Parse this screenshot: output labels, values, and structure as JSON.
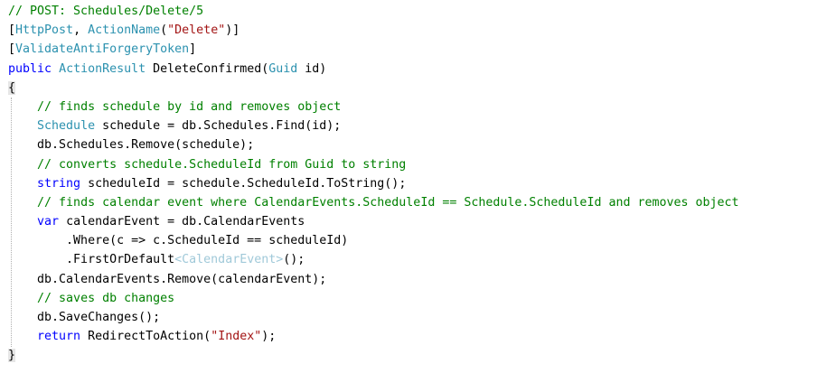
{
  "colors": {
    "comment": "#008000",
    "keyword": "#0000ff",
    "type": "#2b91af",
    "string": "#a31515",
    "plain": "#000000",
    "generic_faded": "#a0c9d9",
    "background": "#ffffff"
  },
  "code": {
    "lines": [
      {
        "indent": 0,
        "tokens": [
          {
            "t": "// POST: Schedules/Delete/5",
            "k": "comment"
          }
        ]
      },
      {
        "indent": 0,
        "tokens": [
          {
            "t": "[",
            "k": "plain"
          },
          {
            "t": "HttpPost",
            "k": "type"
          },
          {
            "t": ", ",
            "k": "plain"
          },
          {
            "t": "ActionName",
            "k": "type"
          },
          {
            "t": "(",
            "k": "plain"
          },
          {
            "t": "\"Delete\"",
            "k": "string"
          },
          {
            "t": ")]",
            "k": "plain"
          }
        ]
      },
      {
        "indent": 0,
        "tokens": [
          {
            "t": "[",
            "k": "plain"
          },
          {
            "t": "ValidateAntiForgeryToken",
            "k": "type"
          },
          {
            "t": "]",
            "k": "plain"
          }
        ]
      },
      {
        "indent": 0,
        "tokens": [
          {
            "t": "public",
            "k": "keyword"
          },
          {
            "t": " ",
            "k": "plain"
          },
          {
            "t": "ActionResult",
            "k": "type"
          },
          {
            "t": " DeleteConfirmed(",
            "k": "plain"
          },
          {
            "t": "Guid",
            "k": "type"
          },
          {
            "t": " id)",
            "k": "plain"
          }
        ]
      },
      {
        "indent": 0,
        "tokens": [
          {
            "t": "{",
            "k": "brace"
          }
        ]
      },
      {
        "indent": 4,
        "tokens": [
          {
            "t": "// finds schedule by id and removes object",
            "k": "comment"
          }
        ]
      },
      {
        "indent": 4,
        "tokens": [
          {
            "t": "Schedule",
            "k": "type"
          },
          {
            "t": " schedule = db.Schedules.Find(id);",
            "k": "plain"
          }
        ]
      },
      {
        "indent": 4,
        "tokens": [
          {
            "t": "db.Schedules.Remove(schedule);",
            "k": "plain"
          }
        ]
      },
      {
        "indent": 4,
        "tokens": [
          {
            "t": "// converts schedule.ScheduleId from Guid to string",
            "k": "comment"
          }
        ]
      },
      {
        "indent": 4,
        "tokens": [
          {
            "t": "string",
            "k": "keyword"
          },
          {
            "t": " scheduleId = schedule.ScheduleId.ToString();",
            "k": "plain"
          }
        ]
      },
      {
        "indent": 4,
        "tokens": [
          {
            "t": "// finds calendar event where CalendarEvents.ScheduleId == Schedule.ScheduleId and removes object",
            "k": "comment"
          }
        ]
      },
      {
        "indent": 4,
        "tokens": [
          {
            "t": "var",
            "k": "keyword"
          },
          {
            "t": " calendarEvent = db.CalendarEvents",
            "k": "plain"
          }
        ]
      },
      {
        "indent": 8,
        "tokens": [
          {
            "t": ".Where(c => c.ScheduleId == scheduleId)",
            "k": "plain"
          }
        ]
      },
      {
        "indent": 8,
        "tokens": [
          {
            "t": ".FirstOrDefault",
            "k": "plain"
          },
          {
            "t": "<",
            "k": "faded"
          },
          {
            "t": "CalendarEvent",
            "k": "faded"
          },
          {
            "t": ">",
            "k": "faded"
          },
          {
            "t": "();",
            "k": "plain"
          }
        ]
      },
      {
        "indent": 4,
        "tokens": [
          {
            "t": "db.CalendarEvents.Remove(calendarEvent);",
            "k": "plain"
          }
        ]
      },
      {
        "indent": 4,
        "tokens": [
          {
            "t": "// saves db changes",
            "k": "comment"
          }
        ]
      },
      {
        "indent": 4,
        "tokens": [
          {
            "t": "db.SaveChanges();",
            "k": "plain"
          }
        ]
      },
      {
        "indent": 4,
        "tokens": [
          {
            "t": "return",
            "k": "keyword"
          },
          {
            "t": " RedirectToAction(",
            "k": "plain"
          },
          {
            "t": "\"Index\"",
            "k": "string"
          },
          {
            "t": ");",
            "k": "plain"
          }
        ]
      },
      {
        "indent": 0,
        "tokens": [
          {
            "t": "}",
            "k": "brace"
          }
        ]
      }
    ]
  }
}
